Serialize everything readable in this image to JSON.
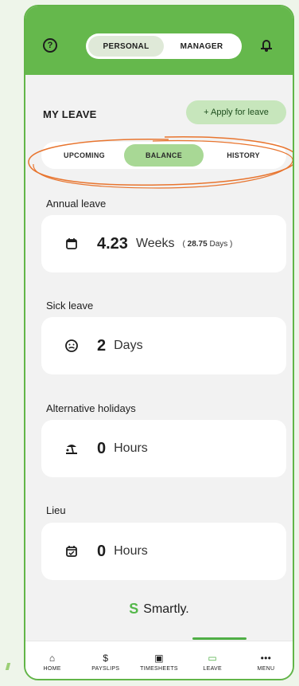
{
  "header": {
    "toggle_options": [
      "PERSONAL",
      "MANAGER"
    ],
    "active_toggle": "PERSONAL"
  },
  "my_leave": {
    "title": "MY LEAVE",
    "apply_label": "+ Apply for leave"
  },
  "tabs": [
    "UPCOMING",
    "BALANCE",
    "HISTORY"
  ],
  "active_tab": "BALANCE",
  "balances": [
    {
      "title": "Annual leave",
      "value": "4.23",
      "unit": "Weeks",
      "secondary_value": "28.75",
      "secondary_unit": "Days",
      "icon": "calendar-icon"
    },
    {
      "title": "Sick leave",
      "value": "2",
      "unit": "Days",
      "icon": "sick-face-icon"
    },
    {
      "title": "Alternative holidays",
      "value": "0",
      "unit": "Hours",
      "icon": "beach-icon"
    },
    {
      "title": "Lieu",
      "value": "0",
      "unit": "Hours",
      "icon": "calendar-check-icon"
    }
  ],
  "brand": {
    "name": "Smartly.",
    "mark": "S"
  },
  "bottom_nav": [
    {
      "label": "HOME",
      "icon": "home-icon"
    },
    {
      "label": "PAYSLIPS",
      "icon": "dollar-icon"
    },
    {
      "label": "TIMESHEETS",
      "icon": "timesheet-icon"
    },
    {
      "label": "LEAVE",
      "icon": "calendar-icon"
    },
    {
      "label": "MENU",
      "icon": "more-icon"
    }
  ],
  "active_nav": "LEAVE",
  "colors": {
    "brand_green": "#65b84c",
    "active_tab": "#a8d895",
    "apply_button": "#c7e6bc",
    "annotation": "#e8752f"
  }
}
